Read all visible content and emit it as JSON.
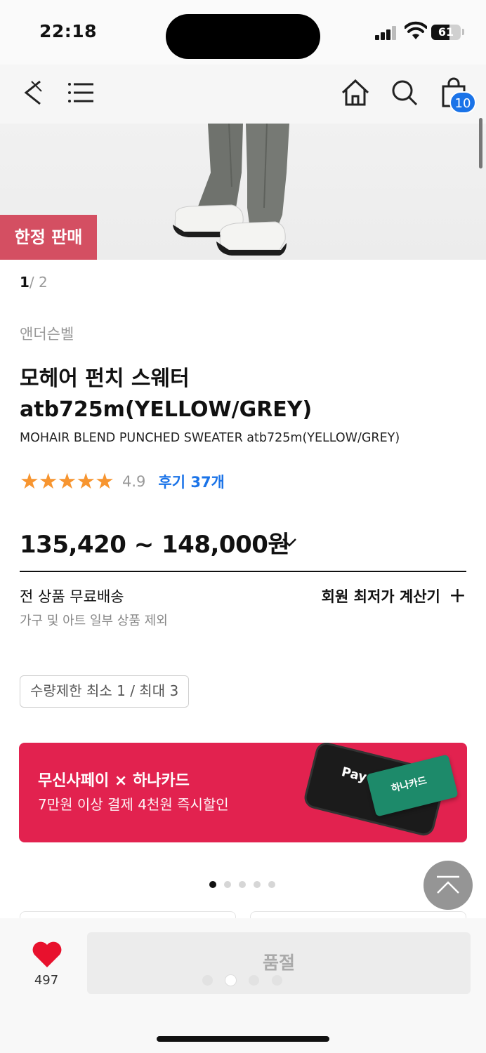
{
  "status_bar": {
    "time": "22:18",
    "battery": "61"
  },
  "nav": {
    "cart_count": "10"
  },
  "hero": {
    "badge": "한정 판매"
  },
  "pager": {
    "current": "1",
    "separator": "/",
    "total": "2"
  },
  "product": {
    "brand": "앤더슨벨",
    "title_line1": "모헤어 펀치 스웨터",
    "title_line2": "atb725m(YELLOW/GREY)",
    "subtitle": "MOHAIR BLEND PUNCHED SWEATER atb725m(YELLOW/GREY)",
    "stars": "★★★★★",
    "rating": "4.9",
    "reviews": "후기 37개",
    "price": "135,420 ~ 148,000원"
  },
  "shipping": {
    "title": "전 상품 무료배송",
    "note": "가구 및 아트 일부 상품 제외",
    "calculator": "회원 최저가 계산기",
    "calculator_icon": "+"
  },
  "quantity_limit": "수량제한 최소 1 / 최대 3",
  "promo": {
    "title": "무신사페이 × 하나카드",
    "subtitle": "7만원 이상 결제 4천원 즉시할인",
    "pay_label": "Pay",
    "card_label": "하나카드",
    "color": "#e2224f"
  },
  "banner_dots": {
    "count": 5,
    "active": 0
  },
  "bottom": {
    "like_count": "497",
    "soldout": "품절"
  },
  "colors": {
    "accent_blue": "#1a73e8",
    "star": "#f79530",
    "like": "#e8112d"
  }
}
